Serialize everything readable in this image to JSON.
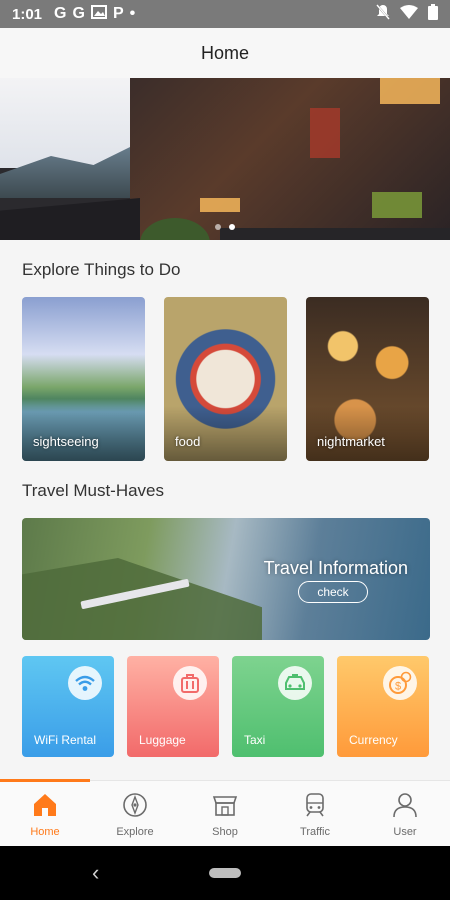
{
  "status": {
    "time": "1:01",
    "icons": [
      "G",
      "G",
      "photo-icon",
      "P",
      "•"
    ],
    "right_icons": [
      "mute-icon",
      "wifi-icon",
      "battery-icon"
    ]
  },
  "header": {
    "title": "Home"
  },
  "hero": {
    "dots": 2,
    "active_dot": 1
  },
  "explore": {
    "title": "Explore Things to Do",
    "cards": [
      {
        "label": "sightseeing"
      },
      {
        "label": "food"
      },
      {
        "label": "nightmarket"
      }
    ]
  },
  "must_haves": {
    "title": "Travel Must-Haves",
    "banner": {
      "title": "Travel Information",
      "button": "check"
    },
    "tiles": [
      {
        "label": "WiFi Rental",
        "icon": "wifi-icon"
      },
      {
        "label": "Luggage",
        "icon": "luggage-icon"
      },
      {
        "label": "Taxi",
        "icon": "taxi-icon"
      },
      {
        "label": "Currency",
        "icon": "currency-icon"
      }
    ]
  },
  "tabs": [
    {
      "label": "Home",
      "icon": "home-icon",
      "active": true
    },
    {
      "label": "Explore",
      "icon": "compass-icon"
    },
    {
      "label": "Shop",
      "icon": "shop-icon"
    },
    {
      "label": "Traffic",
      "icon": "train-icon"
    },
    {
      "label": "User",
      "icon": "user-icon"
    }
  ],
  "colors": {
    "accent": "#ff7a1a"
  }
}
